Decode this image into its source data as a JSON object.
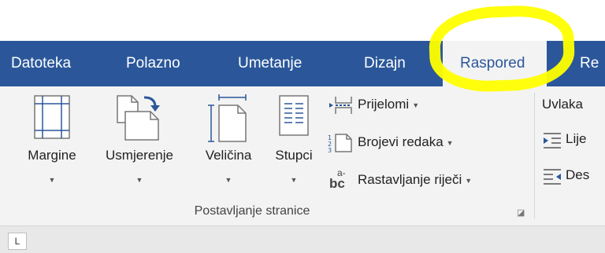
{
  "tabs": [
    {
      "label": "Datoteka"
    },
    {
      "label": "Polazno"
    },
    {
      "label": "Umetanje"
    },
    {
      "label": "Dizajn"
    },
    {
      "label": "Raspored"
    },
    {
      "label": "Re"
    }
  ],
  "active_tab": "Raspored",
  "highlight_color": "#ffff00",
  "ribbon": {
    "margine": "Margine",
    "usmjerenje": "Usmjerenje",
    "velicina": "Veličina",
    "stupci": "Stupci",
    "prijelomi": "Prijelomi",
    "brojevi_redaka": "Brojevi redaka",
    "rastavljanje": "Rastavljanje riječi",
    "rastavljanje_icon_text": "bc",
    "rastavljanje_icon_sup": "a-",
    "group_label": "Postavljanje stranice",
    "uvlaka": "Uvlaka",
    "lijevo": "Lije",
    "desno": "Des"
  },
  "ruler_corner_glyph": "L",
  "colors": {
    "tabbar": "#2b579a",
    "ribbon": "#f3f3f3",
    "icon_blue": "#2b579a",
    "icon_gray": "#777777"
  }
}
